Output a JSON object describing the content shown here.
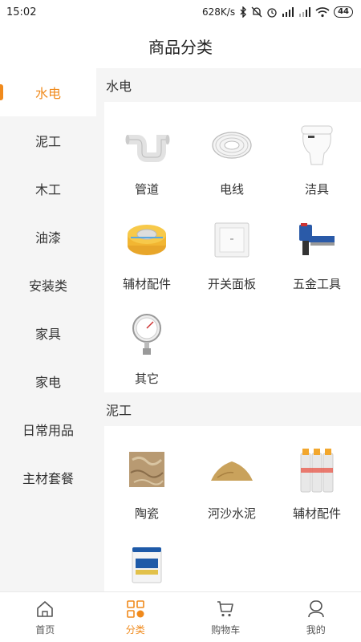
{
  "status": {
    "time": "15:02",
    "speed": "628K/s",
    "battery": "44"
  },
  "header": {
    "title": "商品分类"
  },
  "sidebar": {
    "items": [
      {
        "label": "水电",
        "active": true
      },
      {
        "label": "泥工"
      },
      {
        "label": "木工"
      },
      {
        "label": "油漆"
      },
      {
        "label": "安装类"
      },
      {
        "label": "家具"
      },
      {
        "label": "家电"
      },
      {
        "label": "日常用品"
      },
      {
        "label": "主材套餐"
      }
    ]
  },
  "sections": [
    {
      "title": "水电",
      "items": [
        {
          "label": "管道",
          "icon": "pipe-icon"
        },
        {
          "label": "电线",
          "icon": "wire-coil-icon"
        },
        {
          "label": "洁具",
          "icon": "toilet-icon"
        },
        {
          "label": "辅材配件",
          "icon": "tape-roll-icon"
        },
        {
          "label": "开关面板",
          "icon": "switch-panel-icon"
        },
        {
          "label": "五金工具",
          "icon": "nail-gun-icon"
        },
        {
          "label": "其它",
          "icon": "pressure-gauge-icon"
        }
      ]
    },
    {
      "title": "泥工",
      "items": [
        {
          "label": "陶瓷",
          "icon": "tile-icon"
        },
        {
          "label": "河沙水泥",
          "icon": "sand-pile-icon"
        },
        {
          "label": "辅材配件",
          "icon": "sealant-tubes-icon"
        },
        {
          "label": "",
          "icon": "paint-bucket-icon"
        }
      ]
    }
  ],
  "tabbar": {
    "items": [
      {
        "label": "首页",
        "icon": "home-icon"
      },
      {
        "label": "分类",
        "icon": "category-icon",
        "active": true
      },
      {
        "label": "购物车",
        "icon": "cart-icon"
      },
      {
        "label": "我的",
        "icon": "profile-icon"
      }
    ]
  },
  "colors": {
    "accent": "#f08a1c",
    "background": "#f5f5f5"
  }
}
